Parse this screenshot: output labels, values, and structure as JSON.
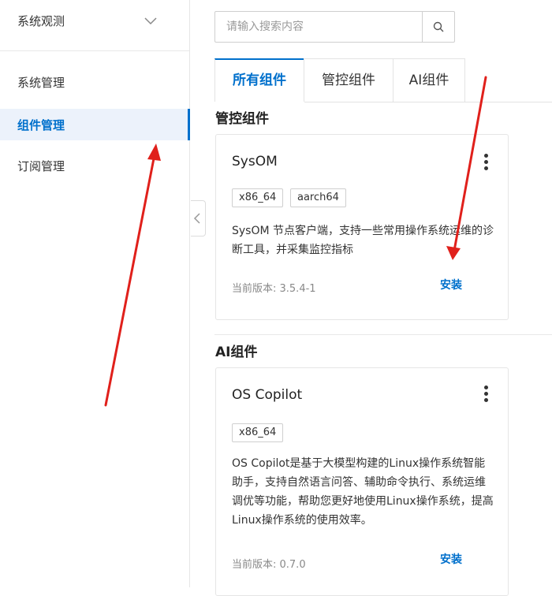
{
  "sidebar": {
    "header_title": "系统观测",
    "items": [
      {
        "label": "系统管理"
      },
      {
        "label": "组件管理"
      },
      {
        "label": "订阅管理"
      }
    ]
  },
  "search": {
    "placeholder": "请输入搜索内容"
  },
  "tabs": [
    {
      "label": "所有组件"
    },
    {
      "label": "管控组件"
    },
    {
      "label": "AI组件"
    }
  ],
  "sections": [
    {
      "title": "管控组件",
      "card": {
        "name": "SysOM",
        "tags": [
          "x86_64",
          "aarch64"
        ],
        "description": "SysOM 节点客户端，支持一些常用操作系统运维的诊断工具，并采集监控指标",
        "version": "当前版本: 3.5.4-1",
        "action": "安装"
      }
    },
    {
      "title": "AI组件",
      "card": {
        "name": "OS Copilot",
        "tags": [
          "x86_64"
        ],
        "description": "OS Copilot是基于大模型构建的Linux操作系统智能助手，支持自然语言问答、辅助命令执行、系统运维调优等功能，帮助您更好地使用Linux操作系统，提高Linux操作系统的使用效率。",
        "version": "当前版本: 0.7.0",
        "action": "安装"
      }
    }
  ],
  "colors": {
    "accent": "#0070cc",
    "annotation": "#e0201b"
  },
  "icons": {
    "header_chevron": "chevron-down-icon",
    "search_button": "search-icon",
    "collapse": "chevron-left-icon",
    "card_menu": "more-vertical-icon"
  }
}
